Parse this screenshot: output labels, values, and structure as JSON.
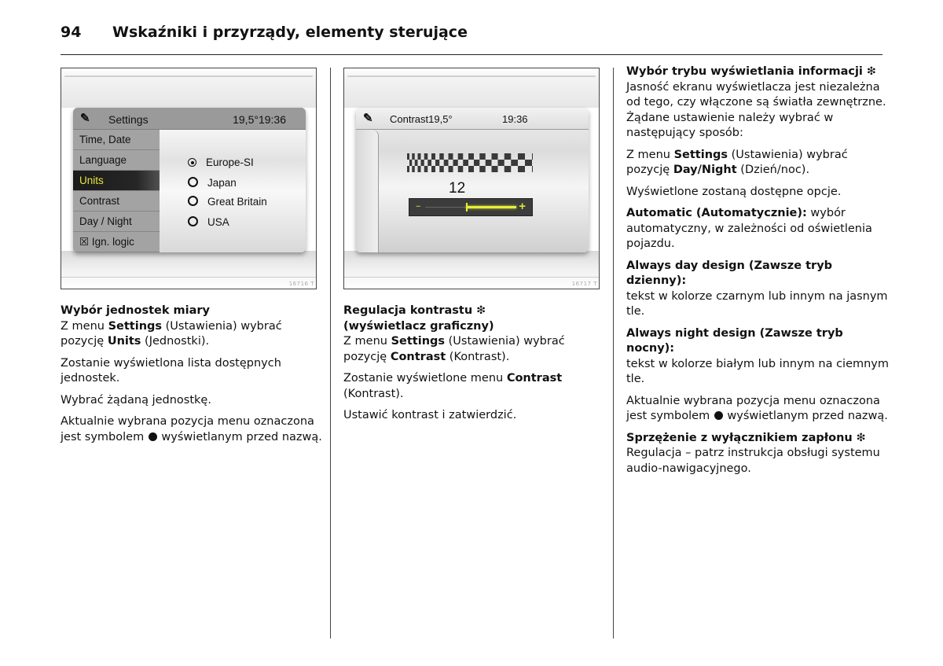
{
  "page": {
    "number": "94",
    "title": "Wskaźniki i przyrządy, elementy sterujące"
  },
  "figure_units": {
    "figure_id": "16716 T",
    "header_icon": "settings-wrench-icon",
    "header_label": "Settings",
    "header_value": "19,5°19:36",
    "menu": [
      {
        "label": "Time, Date",
        "selected": false
      },
      {
        "label": "Language",
        "selected": false
      },
      {
        "label": "Units",
        "selected": true
      },
      {
        "label": "Contrast",
        "selected": false
      },
      {
        "label": "Day / Night",
        "selected": false
      },
      {
        "label": "☒ Ign. logic",
        "selected": false
      }
    ],
    "options": [
      {
        "label": "Europe-SI",
        "checked": true
      },
      {
        "label": "Japan",
        "checked": false
      },
      {
        "label": "Great Britain",
        "checked": false
      },
      {
        "label": "USA",
        "checked": false
      }
    ],
    "colors": {
      "selected_text": "#e8e63a",
      "selected_bg": "#1a1a1a"
    }
  },
  "figure_contrast": {
    "figure_id": "16717 T",
    "header_icon": "settings-wrench-icon",
    "header_label": "Contrast19,5°",
    "header_value": "19:36",
    "value": "12",
    "slider_fraction": 0.7,
    "colors": {
      "slider_fill": "#e6f03a",
      "slider_bg": "#3c3c3c"
    }
  },
  "col1": {
    "heading": "Wybór jednostek miary",
    "p1_a": "Z menu ",
    "p1_b": "Settings",
    "p1_c": " (Ustawienia) wybrać pozycję ",
    "p1_d": "Units",
    "p1_e": " (Jednostki).",
    "p2": "Zostanie wyświetlona lista dostępnych jednostek.",
    "p3": "Wybrać żądaną jednostkę.",
    "p4_a": "Aktualnie wybrana pozycja menu oznaczona jest symbolem ",
    "p4_b": " wyświetlanym przed nazwą."
  },
  "col2": {
    "heading_1": "Regulacja kontrastu ",
    "heading_2": "(wyświetlacz graficzny)",
    "p1_a": "Z menu ",
    "p1_b": "Settings",
    "p1_c": " (Ustawienia) wybrać pozycję ",
    "p1_d": "Contrast",
    "p1_e": " (Kontrast).",
    "p2_a": "Zostanie wyświetlone menu ",
    "p2_b": "Contrast",
    "p2_c": " (Kontrast).",
    "p3": "Ustawić kontrast i zatwierdzić."
  },
  "col3": {
    "heading": "Wybór trybu wyświetlania informacji ",
    "intro": "Jasność ekranu wyświetlacza jest niezależna od tego, czy włączone są światła zewnętrzne. Żądane ustawienie należy wybrać w następujący sposób:",
    "p1_a": "Z menu ",
    "p1_b": "Settings",
    "p1_c": " (Ustawienia) wybrać pozycję ",
    "p1_d": "Day/Night",
    "p1_e": " (Dzień/noc).",
    "p2": "Wyświetlone zostaną dostępne opcje.",
    "auto_label": "Automatic (Automatycznie):",
    "auto_text": " wybór automatyczny, w zależności od oświetlenia pojazdu.",
    "day_label": "Always day design (Zawsze tryb dzienny):",
    "day_text": "tekst w kolorze czarnym lub innym na jasnym tle.",
    "night_label": "Always night design (Zawsze tryb nocny):",
    "night_text": "tekst w kolorze białym lub innym na ciemnym tle.",
    "p3_a": "Aktualnie wybrana pozycja menu oznaczona jest symbolem ",
    "p3_b": " wyświetlanym przed nazwą.",
    "ign_heading": "Sprzężenie z wyłącznikiem zapłonu ",
    "ign_text": "Regulacja – patrz instrukcja obsługi systemu audio-nawigacyjnego."
  },
  "symbols": {
    "optional_equipment": "❇"
  }
}
